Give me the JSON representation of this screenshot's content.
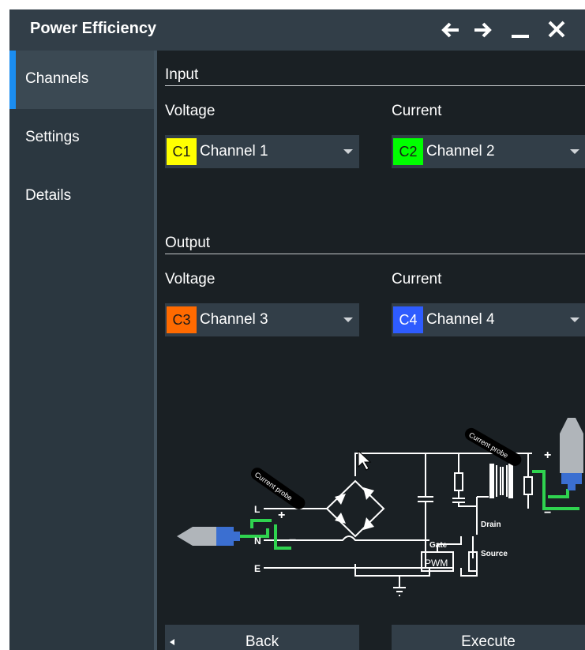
{
  "window": {
    "title": "Power Efficiency",
    "buttons": [
      "back-arrow",
      "forward-arrow",
      "minimize",
      "close"
    ]
  },
  "sidebar": {
    "items": [
      {
        "label": "Channels",
        "active": true
      },
      {
        "label": "Settings",
        "active": false
      },
      {
        "label": "Details",
        "active": false
      }
    ]
  },
  "input": {
    "title": "Input",
    "voltage": {
      "label": "Voltage",
      "chip": "C1",
      "chip_color": "#ffff00",
      "value": "Channel 1"
    },
    "current": {
      "label": "Current",
      "chip": "C2",
      "chip_color": "#00ff00",
      "value": "Channel 2"
    }
  },
  "output": {
    "title": "Output",
    "voltage": {
      "label": "Voltage",
      "chip": "C3",
      "chip_color": "#ff6a00",
      "value": "Channel 3"
    },
    "current": {
      "label": "Current",
      "chip": "C4",
      "chip_color": "#2e5cff",
      "value": "Channel 4"
    }
  },
  "diagram": {
    "probe_label_left": "Current probe",
    "probe_label_right": "Current probe",
    "line_labels": [
      "L",
      "N",
      "E"
    ],
    "plus": "+",
    "minus": "−",
    "gate": "Gate",
    "drain": "Drain",
    "source": "Source",
    "pwm": "PWM"
  },
  "footer": {
    "back": "Back",
    "execute": "Execute"
  },
  "colors": {
    "accent": "#1b8df0",
    "panel": "#323e48",
    "background": "#1a2024",
    "probe_wire": "#2fd34f"
  }
}
